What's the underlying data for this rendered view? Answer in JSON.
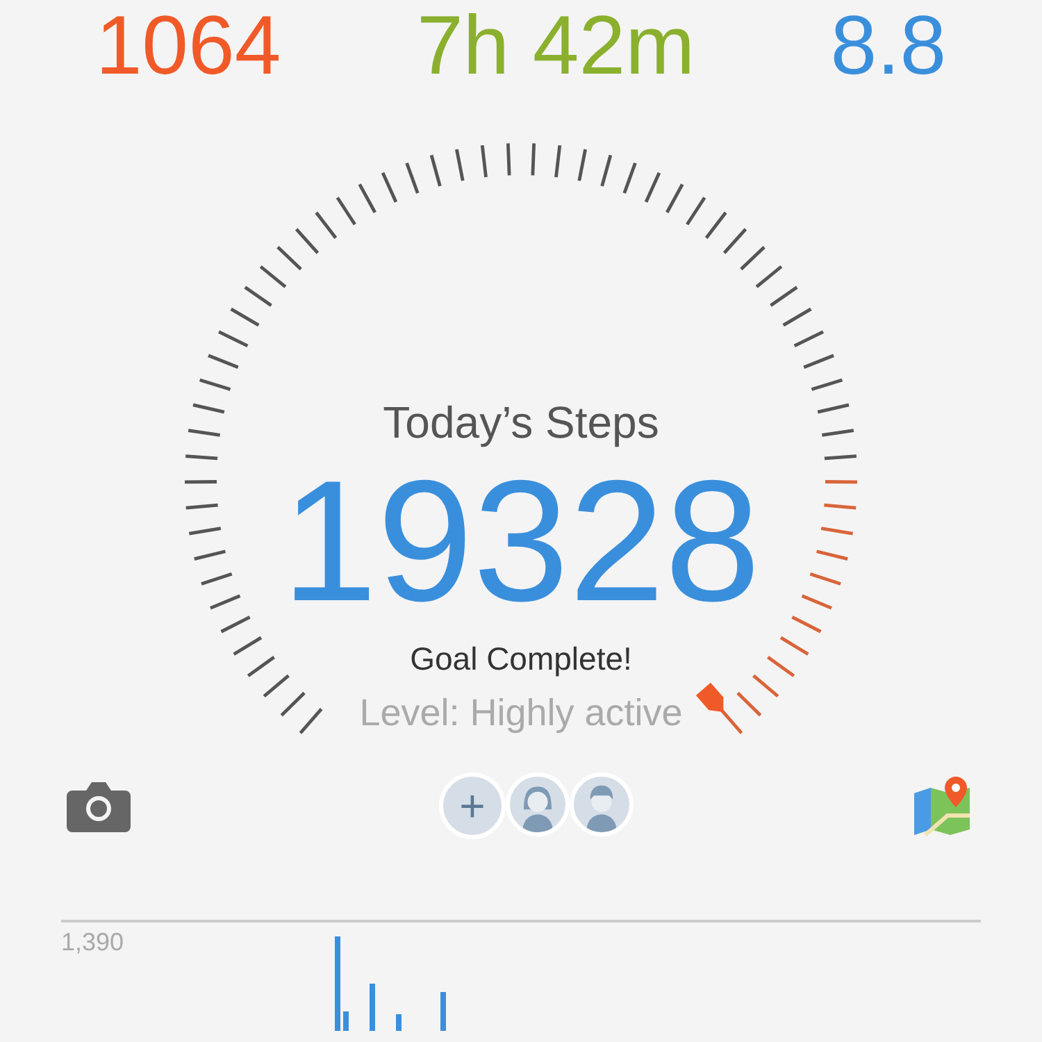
{
  "stats": [
    {
      "value": "1064",
      "color": "#f05a28"
    },
    {
      "value": "7h 42m",
      "color": "#8ab02e"
    },
    {
      "value": "8.8",
      "color": "#3a8fdc"
    }
  ],
  "gauge": {
    "title": "Today’s Steps",
    "steps": "19328",
    "status": "Goal Complete!",
    "activity": "Level: Highly active"
  },
  "companions": {
    "add_label": "+"
  },
  "chart": {
    "max_label": "1,390"
  }
}
